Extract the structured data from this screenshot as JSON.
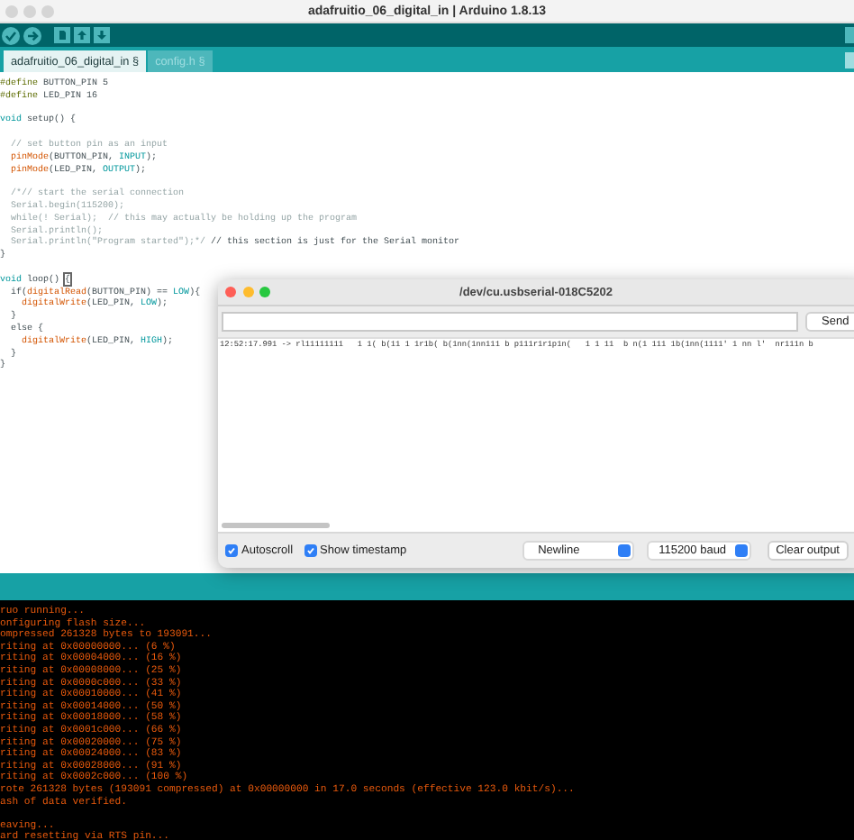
{
  "window": {
    "title": "adafruitio_06_digital_in | Arduino 1.8.13"
  },
  "tabs": [
    {
      "label": "adafruitio_06_digital_in §",
      "selected": true
    },
    {
      "label": "config.h §",
      "selected": false
    }
  ],
  "editor": {
    "blocks": [
      [
        [
          {
            "kind": "preproc",
            "text": "#define"
          },
          {
            "kind": "plain",
            "text": " BUTTON_PIN 5"
          }
        ],
        [
          {
            "kind": "preproc",
            "text": "#define"
          },
          {
            "kind": "plain",
            "text": " LED_PIN 16"
          }
        ]
      ],
      [
        [
          {
            "kind": "type",
            "text": "void"
          },
          {
            "kind": "plain",
            "text": " setup() {"
          }
        ]
      ],
      [
        [
          {
            "kind": "comment",
            "text": "  // set button pin as an input"
          }
        ],
        [
          {
            "kind": "fn",
            "text": "  pinMode"
          },
          {
            "kind": "plain",
            "text": "(BUTTON_PIN, "
          },
          {
            "kind": "const",
            "text": "INPUT"
          },
          {
            "kind": "plain",
            "text": ");"
          }
        ],
        [
          {
            "kind": "fn",
            "text": "  pinMode"
          },
          {
            "kind": "plain",
            "text": "(LED_PIN, "
          },
          {
            "kind": "const",
            "text": "OUTPUT"
          },
          {
            "kind": "plain",
            "text": ");"
          }
        ]
      ],
      [
        [
          {
            "kind": "comment",
            "text": "  /*// start the serial connection"
          }
        ],
        [
          {
            "kind": "comment",
            "text": "  Serial.begin(115200);"
          }
        ],
        [
          {
            "kind": "comment",
            "text": "  while(! Serial);  // this may actually be holding up the program"
          }
        ],
        [
          {
            "kind": "comment",
            "text": "  Serial.println();"
          }
        ],
        [
          {
            "kind": "comment",
            "text": "  Serial.println(\"Program started\");*/"
          },
          {
            "kind": "plain",
            "text": " // this section is just for the Serial monitor"
          }
        ],
        [
          {
            "kind": "plain",
            "text": "}"
          }
        ]
      ],
      [
        [
          {
            "kind": "type",
            "text": "void"
          },
          {
            "kind": "plain",
            "text": " loop() "
          },
          {
            "kind": "match",
            "text": "{"
          }
        ],
        [
          {
            "kind": "plain",
            "text": "  if("
          },
          {
            "kind": "fn",
            "text": "digitalRead"
          },
          {
            "kind": "plain",
            "text": "(BUTTON_PIN) == "
          },
          {
            "kind": "const",
            "text": "LOW"
          },
          {
            "kind": "plain",
            "text": "){"
          }
        ],
        [
          {
            "kind": "fn",
            "text": "    digitalWrite"
          },
          {
            "kind": "plain",
            "text": "(LED_PIN, "
          },
          {
            "kind": "const",
            "text": "LOW"
          },
          {
            "kind": "plain",
            "text": ");"
          }
        ],
        [
          {
            "kind": "plain",
            "text": "  }"
          }
        ],
        [
          {
            "kind": "plain",
            "text": "  else {"
          }
        ],
        [
          {
            "kind": "fn",
            "text": "    digitalWrite"
          },
          {
            "kind": "plain",
            "text": "(LED_PIN, "
          },
          {
            "kind": "const",
            "text": "HIGH"
          },
          {
            "kind": "plain",
            "text": ");"
          }
        ],
        [
          {
            "kind": "plain",
            "text": "  }"
          }
        ],
        [
          {
            "kind": "plain",
            "text": "}"
          }
        ]
      ]
    ]
  },
  "serial_monitor": {
    "title": "/dev/cu.usbserial-018C5202",
    "send_button": "Send",
    "output": [
      "12:52:17.991 -> rl11111111   1 1( b(11 1 1r1b( b(1nn(1nn111 b p111r1r1p1n(   1 1 11  b n(1 111 1b(1nn(1111' 1 nn l'  nr111n b"
    ],
    "options": [
      {
        "label": "Autoscroll",
        "checked": true
      },
      {
        "label": "Show timestamp",
        "checked": true
      }
    ],
    "line_ending": "Newline",
    "baud_rate": "115200 baud",
    "clear_button": "Clear output"
  },
  "console": {
    "blocks": [
      [
        "ruo running...",
        "onfiguring flash size...",
        "ompressed 261328 bytes to 193091...",
        "riting at 0x00000000... (6 %)",
        "riting at 0x00004000... (16 %)",
        "riting at 0x00008000... (25 %)",
        "riting at 0x0000c000... (33 %)",
        "riting at 0x00010000... (41 %)",
        "riting at 0x00014000... (50 %)",
        "riting at 0x00018000... (58 %)",
        "riting at 0x0001c000... (66 %)",
        "riting at 0x00020000... (75 %)",
        "riting at 0x00024000... (83 %)",
        "riting at 0x00028000... (91 %)",
        "riting at 0x0002c000... (100 %)",
        "rote 261328 bytes (193091 compressed) at 0x00000000 in 17.0 seconds (effective 123.0 kbit/s)...",
        "ash of data verified."
      ],
      [
        "eaving...",
        "ard resetting via RTS pin..."
      ]
    ]
  }
}
